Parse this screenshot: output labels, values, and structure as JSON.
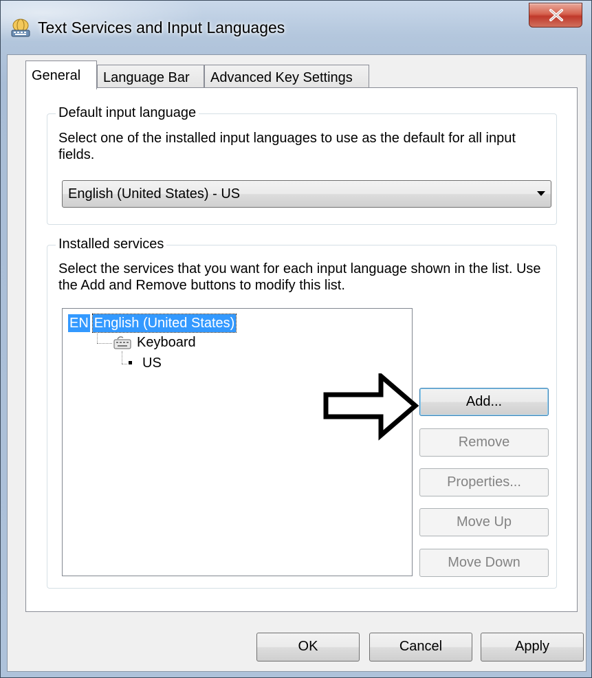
{
  "window": {
    "title": "Text Services and Input Languages",
    "icon": "keyboard-globe-icon",
    "close_icon": "close-icon"
  },
  "tabs": [
    {
      "label": "General",
      "active": true
    },
    {
      "label": "Language Bar",
      "active": false
    },
    {
      "label": "Advanced Key Settings",
      "active": false
    }
  ],
  "default_input": {
    "title": "Default input language",
    "description": "Select one of the installed input languages to use as the default for all input fields.",
    "selected": "English (United States) - US"
  },
  "installed_services": {
    "title": "Installed services",
    "description": "Select the services that you want for each input language shown in the list. Use the Add and Remove buttons to modify this list.",
    "tree": {
      "language_code": "EN",
      "language_name": "English (United States)",
      "category": "Keyboard",
      "layout": "US"
    },
    "buttons": {
      "add": "Add...",
      "remove": "Remove",
      "properties": "Properties...",
      "move_up": "Move Up",
      "move_down": "Move Down"
    }
  },
  "footer": {
    "ok": "OK",
    "cancel": "Cancel",
    "apply": "Apply"
  },
  "colors": {
    "selection": "#3399ff",
    "close_button": "#c0392b",
    "disabled_text": "#838383"
  }
}
